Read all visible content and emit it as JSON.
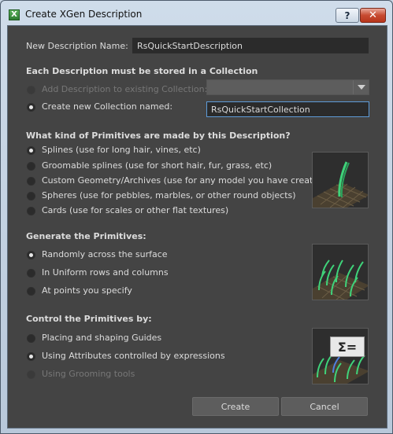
{
  "window": {
    "title": "Create XGen Description",
    "help_label": "?",
    "close_label": "✕"
  },
  "name": {
    "label": "New Description Name:",
    "value": "RsQuickStartDescription"
  },
  "collection": {
    "title": "Each Description must be stored in a Collection",
    "existing_label": "Add Description to existing Collection:",
    "existing_value": "",
    "new_label": "Create new Collection named:",
    "new_value": "RsQuickStartCollection",
    "selected": "new"
  },
  "primitives": {
    "title": "What kind of Primitives are made by this Description?",
    "options": [
      "Splines (use for long hair, vines, etc)",
      "Groomable splines (use for short hair, fur, grass, etc)",
      "Custom Geometry/Archives (use for any model you have created)",
      "Spheres (use for pebbles, marbles, or other round objects)",
      "Cards (use for scales or other flat textures)"
    ],
    "selected_index": 0
  },
  "generate": {
    "title": "Generate the Primitives:",
    "options": [
      "Randomly across the surface",
      "In Uniform rows and columns",
      "At points you specify"
    ],
    "selected_index": 0
  },
  "control": {
    "title": "Control the Primitives by:",
    "options": [
      "Placing and shaping Guides",
      "Using Attributes controlled by expressions",
      "Using Grooming tools"
    ],
    "selected_index": 1,
    "expression_badge": "Σ="
  },
  "buttons": {
    "create": "Create",
    "cancel": "Cancel"
  },
  "colors": {
    "panel": "#444444",
    "field": "#2b2b2b",
    "focus": "#5e9bd8",
    "strand": "#3fd37a"
  }
}
